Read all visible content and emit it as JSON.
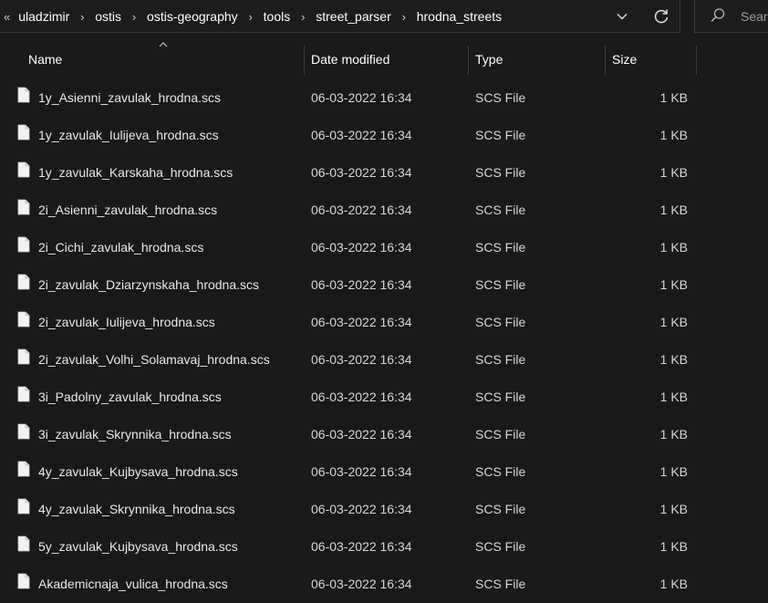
{
  "address_bar": {
    "more_glyph": "«",
    "crumbs": [
      "uladzimir",
      "ostis",
      "ostis-geography",
      "tools",
      "street_parser",
      "hrodna_streets"
    ],
    "separator": "›"
  },
  "search": {
    "placeholder": "Search"
  },
  "columns": {
    "name": "Name",
    "date_modified": "Date modified",
    "type": "Type",
    "size": "Size"
  },
  "files": [
    {
      "name": "1y_Asienni_zavulak_hrodna.scs",
      "date": "06-03-2022 16:34",
      "type": "SCS File",
      "size": "1 KB"
    },
    {
      "name": "1y_zavulak_Iulijeva_hrodna.scs",
      "date": "06-03-2022 16:34",
      "type": "SCS File",
      "size": "1 KB"
    },
    {
      "name": "1y_zavulak_Karskaha_hrodna.scs",
      "date": "06-03-2022 16:34",
      "type": "SCS File",
      "size": "1 KB"
    },
    {
      "name": "2i_Asienni_zavulak_hrodna.scs",
      "date": "06-03-2022 16:34",
      "type": "SCS File",
      "size": "1 KB"
    },
    {
      "name": "2i_Cichi_zavulak_hrodna.scs",
      "date": "06-03-2022 16:34",
      "type": "SCS File",
      "size": "1 KB"
    },
    {
      "name": "2i_zavulak_Dziarzynskaha_hrodna.scs",
      "date": "06-03-2022 16:34",
      "type": "SCS File",
      "size": "1 KB"
    },
    {
      "name": "2i_zavulak_Iulijeva_hrodna.scs",
      "date": "06-03-2022 16:34",
      "type": "SCS File",
      "size": "1 KB"
    },
    {
      "name": "2i_zavulak_Volhi_Solamavaj_hrodna.scs",
      "date": "06-03-2022 16:34",
      "type": "SCS File",
      "size": "1 KB"
    },
    {
      "name": "3i_Padolny_zavulak_hrodna.scs",
      "date": "06-03-2022 16:34",
      "type": "SCS File",
      "size": "1 KB"
    },
    {
      "name": "3i_zavulak_Skrynnika_hrodna.scs",
      "date": "06-03-2022 16:34",
      "type": "SCS File",
      "size": "1 KB"
    },
    {
      "name": "4y_zavulak_Kujbysava_hrodna.scs",
      "date": "06-03-2022 16:34",
      "type": "SCS File",
      "size": "1 KB"
    },
    {
      "name": "4y_zavulak_Skrynnika_hrodna.scs",
      "date": "06-03-2022 16:34",
      "type": "SCS File",
      "size": "1 KB"
    },
    {
      "name": "5y_zavulak_Kujbysava_hrodna.scs",
      "date": "06-03-2022 16:34",
      "type": "SCS File",
      "size": "1 KB"
    },
    {
      "name": "Akademicnaja_vulica_hrodna.scs",
      "date": "06-03-2022 16:34",
      "type": "SCS File",
      "size": "1 KB"
    }
  ],
  "icons": {
    "file": "file-icon",
    "chevron": "chevron-down-icon",
    "refresh": "refresh-icon",
    "search": "search-icon",
    "sort": "sort-arrow-icon"
  },
  "colors": {
    "background": "#191919",
    "text": "#ffffff",
    "muted_text": "#d6d6d6",
    "divider": "#3c3c3c"
  }
}
